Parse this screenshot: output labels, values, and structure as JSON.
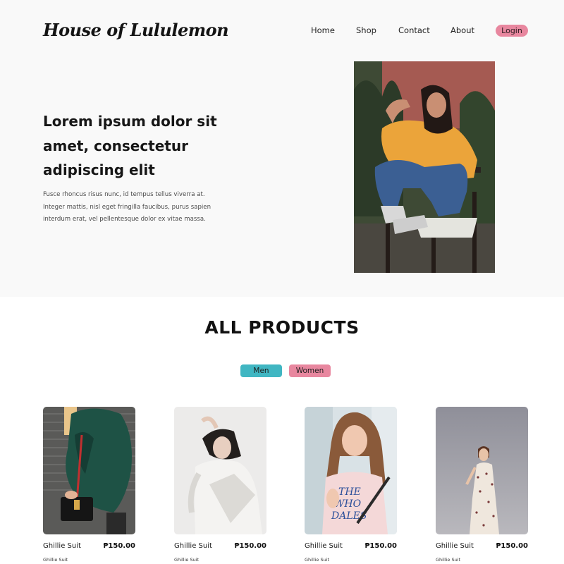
{
  "header": {
    "brand": "House of Lululemon",
    "nav": [
      "Home",
      "Shop",
      "Contact",
      "About"
    ],
    "login_label": "Login"
  },
  "hero": {
    "headline": "Lorem ipsum dolor sit amet, consectetur adipiscing elit",
    "body": "Fusce rhoncus risus nunc, id tempus tellus viverra at. Integer mattis, nisl eget fringilla faucibus, purus sapien interdum erat, vel pellentesque dolor ex vitae massa."
  },
  "products_section": {
    "title": "ALL PRODUCTS",
    "filters": [
      "Men",
      "Women"
    ]
  },
  "products": [
    {
      "name": "Ghillie Suit",
      "price": "₱150.00",
      "subtitle": "Ghillie Suit"
    },
    {
      "name": "Ghillie Suit",
      "price": "₱150.00",
      "subtitle": "Ghillie Suit"
    },
    {
      "name": "Ghillie Suit",
      "price": "₱150.00",
      "subtitle": "Ghillie Suit"
    },
    {
      "name": "Ghillie Suit",
      "price": "₱150.00",
      "subtitle": "Ghillie Suit"
    }
  ],
  "colors": {
    "login_bg": "#e8879f",
    "men_filter_bg": "#40b6c2",
    "women_filter_bg": "#e8879f",
    "hero_bg": "#f9f9f9"
  }
}
